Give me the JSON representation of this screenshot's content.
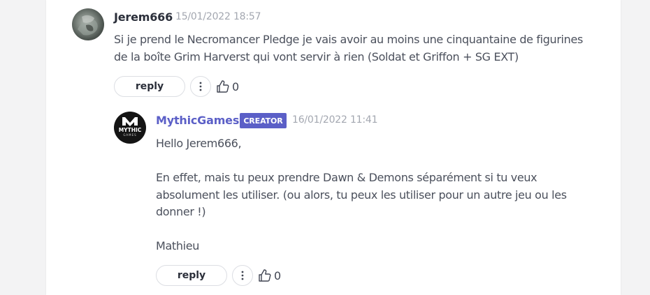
{
  "comment": {
    "author": "Jerem666",
    "timestamp": "15/01/2022 18:57",
    "lines": [
      "Si je prend le Necromancer  Pledge je vais avoir au moins une cinquantaine de figurines",
      "de la boîte Grim Harverst qui vont servir à rien (Soldat et Griffon + SG EXT)"
    ],
    "reply_label": "reply",
    "like_count": "0",
    "avatar_icon": "user-avatar-photo"
  },
  "reply": {
    "author": "MythicGames",
    "badge": "CREATOR",
    "timestamp": "16/01/2022 11:41",
    "greeting": "Hello Jerem666,",
    "paragraph": [
      "En effet, mais tu peux prendre Dawn & Demons séparément si tu veux",
      "absolument les utiliser. (ou alors, tu peux les utiliser pour un autre jeu ou les",
      "donner !)"
    ],
    "signature": "Mathieu",
    "reply_label": "reply",
    "like_count": "0",
    "avatar_icon": "mythic-games-logo",
    "logo_text": "MYTHIC",
    "logo_subtext": "GAMES"
  },
  "colors": {
    "brand": "#5b5fc7",
    "text": "#404552",
    "muted": "#a3a7b0"
  }
}
